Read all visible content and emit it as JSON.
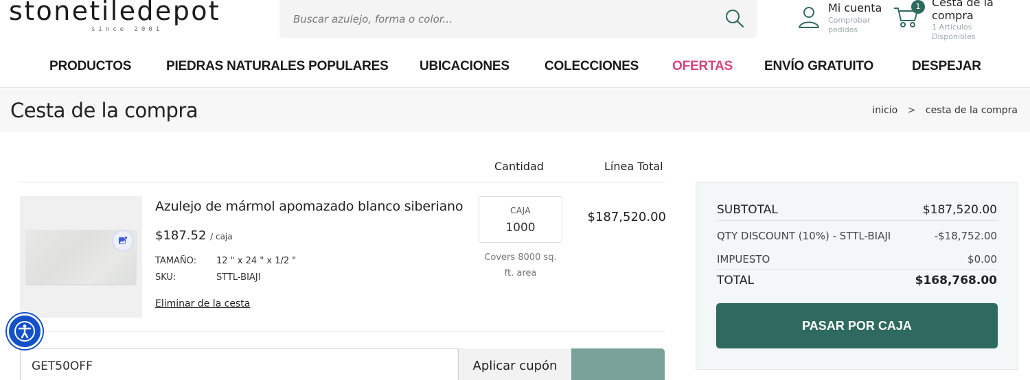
{
  "brand": {
    "logo_text": "stonetiledepot",
    "since": "since 2001"
  },
  "search": {
    "placeholder": "Buscar azulejo, forma o color..."
  },
  "account": {
    "title": "Mi cuenta",
    "subtitle": "Comprobar pedidos"
  },
  "cart_header": {
    "title": "Cesta de la compra",
    "badge": "1",
    "subtitle": "1 Artículos Disponibles"
  },
  "nav": {
    "items": [
      "PRODUCTOS",
      "PIEDRAS NATURALES POPULARES",
      "UBICACIONES",
      "COLECCIONES",
      "OFERTAS",
      "ENVÍO GRATUITO",
      "DESPEJAR"
    ]
  },
  "page": {
    "title": "Cesta de la compra",
    "breadcrumb": [
      "inicio",
      ">",
      "cesta de la compra"
    ]
  },
  "cart_table": {
    "headers": {
      "quantity": "Cantidad",
      "line_total": "Línea Total"
    },
    "item": {
      "name": "Azulejo de mármol apomazado blanco siberiano",
      "price": "$187.52",
      "price_unit": "/ caja",
      "size_label": "TAMAÑO:",
      "size_value": "12 \" x 24 \" x 1/2 \"",
      "sku_label": "SKU:",
      "sku_value": "STTL-BIAJI",
      "remove_label": "Eliminar de la cesta",
      "qty_unit": "CAJA",
      "qty_value": "1000",
      "covers_line1": "Covers 8000 sq.",
      "covers_line2": "ft. area",
      "line_total": "$187,520.00"
    }
  },
  "coupon": {
    "value": "GET50OFF",
    "apply_label": "Aplicar cupón"
  },
  "summary": {
    "subtotal_label": "SUBTOTAL",
    "subtotal_value": "$187,520.00",
    "discount_label": "QTY DISCOUNT (10%) - STTL-BIAJI",
    "discount_value": "-$18,752.00",
    "tax_label": "IMPUESTO",
    "tax_value": "$0.00",
    "total_label": "TOTAL",
    "total_value": "$168,768.00",
    "checkout_label": "PASAR POR CAJA"
  },
  "colors": {
    "accent_green": "#2e6a5f",
    "offer_pink": "#d6447a",
    "a11y_blue": "#1450c8"
  }
}
